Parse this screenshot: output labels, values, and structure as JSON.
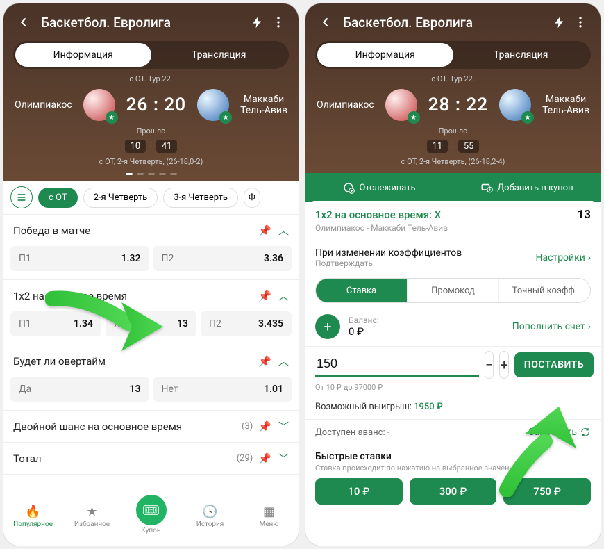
{
  "left": {
    "header": {
      "title": "Баскетбол. Евролига",
      "tabs": {
        "info": "Информация",
        "stream": "Трансляция"
      },
      "tour": "с ОТ. Тур 22.",
      "team1": "Олимпиакос",
      "team2_line1": "Маккаби",
      "team2_line2": "Тель-Авив",
      "score": "26 : 20",
      "elapsed_label": "Прошло",
      "t_min": "10",
      "t_sec": "41",
      "status": "с ОТ, 2-я Четверть, (26-18,0-2)"
    },
    "filters": [
      "с ОТ",
      "2-я Четверть",
      "3-я Четверть",
      "Ф"
    ],
    "markets": [
      {
        "name": "Победа в матче",
        "odds": [
          [
            "П1",
            "1.32"
          ],
          [
            "П2",
            "3.36"
          ]
        ]
      },
      {
        "name": "1х2 на основное время",
        "odds": [
          [
            "П1",
            "1.34"
          ],
          [
            "Х",
            "13"
          ],
          [
            "П2",
            "3.435"
          ]
        ]
      },
      {
        "name": "Будет ли овертайм",
        "odds": [
          [
            "Да",
            "13"
          ],
          [
            "Нет",
            "1.01"
          ]
        ]
      },
      {
        "name": "Двойной шанс на основное время",
        "count": "(3)"
      },
      {
        "name": "Тотал",
        "count": "(29)"
      }
    ],
    "nav": {
      "popular": "Популярное",
      "fav": "Избранное",
      "coupon": "Купон",
      "history": "История",
      "menu": "Меню"
    }
  },
  "right": {
    "header": {
      "title": "Баскетбол. Евролига",
      "tabs": {
        "info": "Информация",
        "stream": "Трансляция"
      },
      "tour": "с ОТ. Тур 22.",
      "team1": "Олимпиакос",
      "team2_line1": "Маккаби",
      "team2_line2": "Тель-Авив",
      "score": "28 : 22",
      "elapsed_label": "Прошло",
      "t_min": "11",
      "t_sec": "55",
      "status": "с ОТ, 2-я Четверть, (26-18,2-4)"
    },
    "actions": {
      "track": "Отслеживать",
      "add": "Добавить в купон"
    },
    "slip": {
      "title": "1х2 на основное время: Х",
      "odd": "13",
      "match": "Олимпиакос - Маккаби Тель-Авив",
      "change_label": "При изменении коэффициентов",
      "confirm_label": "Подтверждать",
      "settings": "Настройки",
      "seg": [
        "Ставка",
        "Промокод",
        "Точный коэфф."
      ],
      "balance_label": "Баланс:",
      "balance_value": "0 ₽",
      "topup": "Пополнить счет",
      "stake": "150",
      "range": "От 10 ₽ до 97000 ₽",
      "submit": "ПОСТАВИТЬ",
      "possible_label": "Возможный выигрыш: ",
      "possible_value": "1950 ₽",
      "advance_label": "Доступен аванс: -",
      "request": "Запросить",
      "quick_title": "Быстрые ставки",
      "quick_sub": "Ставка происходит по нажатию на выбранное значение",
      "quick": [
        "10 ₽",
        "300 ₽",
        "750 ₽"
      ]
    }
  }
}
